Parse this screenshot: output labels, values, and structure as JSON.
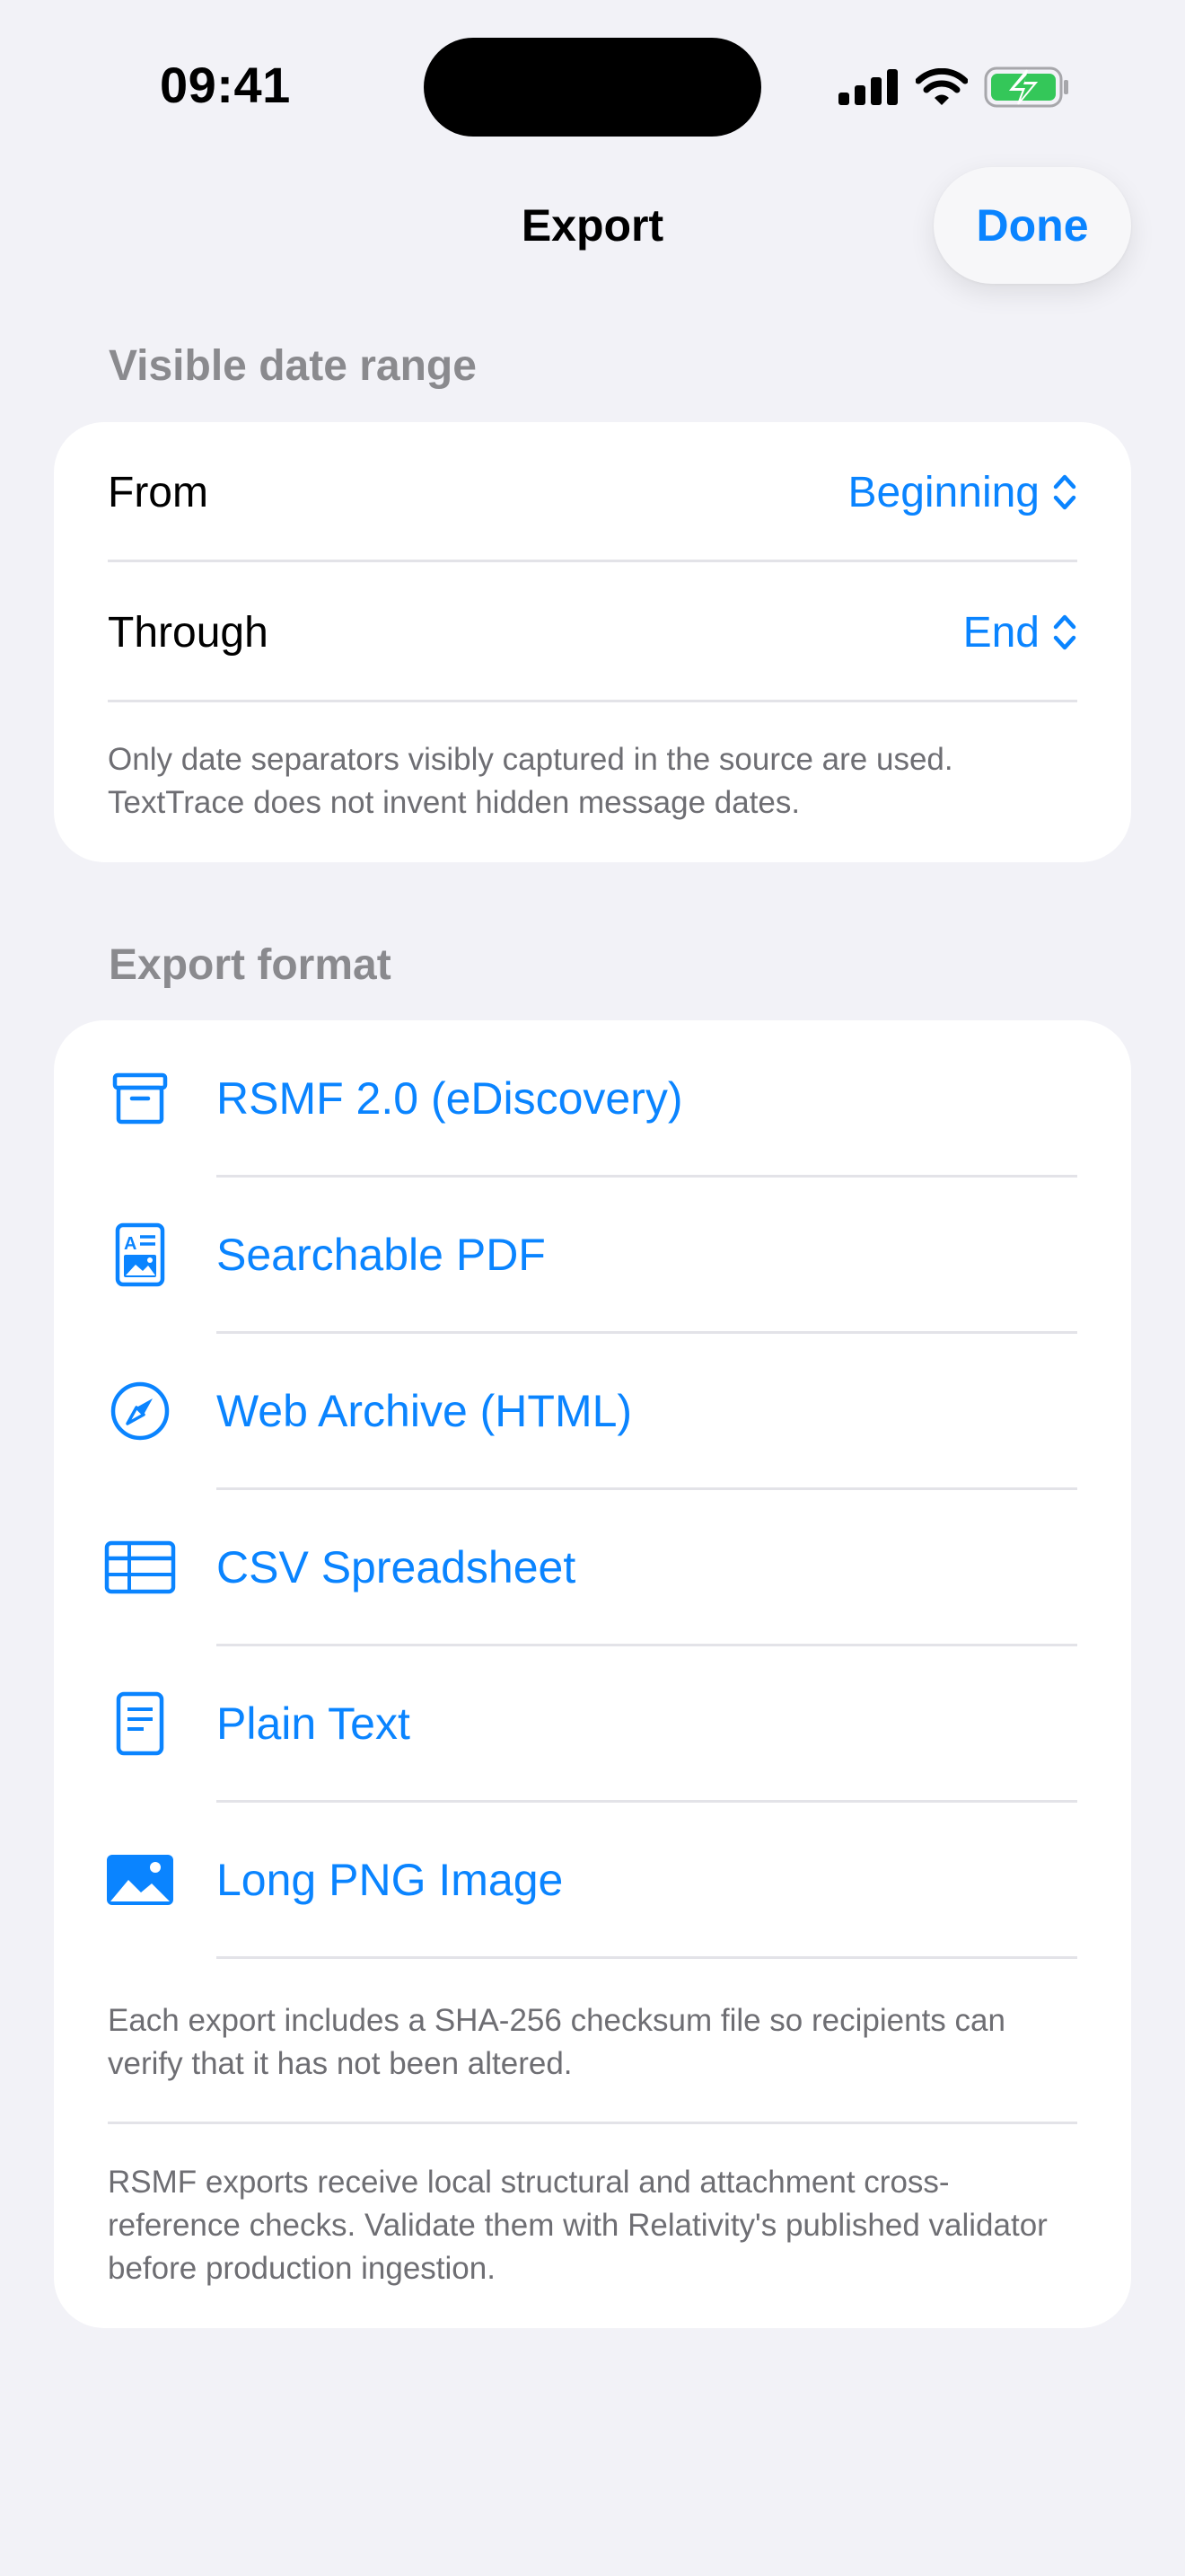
{
  "status_bar": {
    "time": "09:41"
  },
  "nav": {
    "title": "Export",
    "done_label": "Done"
  },
  "date_range": {
    "header": "Visible date range",
    "rows": [
      {
        "label": "From",
        "value": "Beginning"
      },
      {
        "label": "Through",
        "value": "End"
      }
    ],
    "note": "Only date separators visibly captured in the source are used. TextTrace does not invent hidden message dates."
  },
  "export_format": {
    "header": "Export format",
    "items": [
      {
        "label": "RSMF 2.0 (eDiscovery)",
        "icon": "archive-box-icon"
      },
      {
        "label": "Searchable PDF",
        "icon": "document-image-icon"
      },
      {
        "label": "Web Archive (HTML)",
        "icon": "compass-icon"
      },
      {
        "label": "CSV Spreadsheet",
        "icon": "table-icon"
      },
      {
        "label": "Plain Text",
        "icon": "text-document-icon"
      },
      {
        "label": "Long PNG Image",
        "icon": "photo-icon"
      }
    ],
    "note_checksum": "Each export includes a SHA-256 checksum file so recipients can verify that it has not been altered.",
    "note_rsmf": "RSMF exports receive local structural and attachment cross-reference checks. Validate them with Relativity's published validator before production ingestion."
  },
  "colors": {
    "accent": "#0A84FF",
    "background": "#F2F2F7",
    "battery": "#34C759"
  }
}
